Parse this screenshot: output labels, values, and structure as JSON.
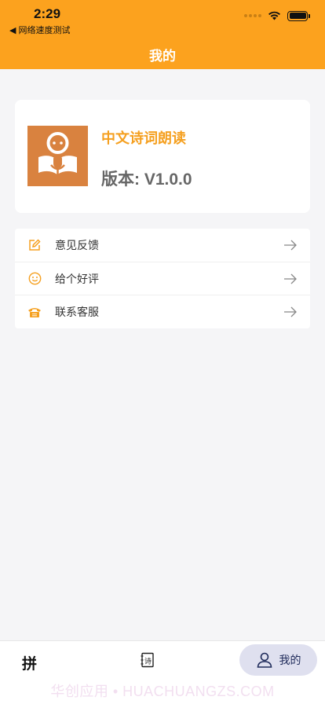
{
  "status_bar": {
    "time": "2:29",
    "back_app": "◀ 网络速度测试"
  },
  "nav": {
    "title": "我的"
  },
  "app_info": {
    "name": "中文诗词朗读",
    "version": "版本: V1.0.0",
    "logo_color": "#d9823f"
  },
  "menu": {
    "items": [
      {
        "label": "意见反馈",
        "icon": "edit-icon"
      },
      {
        "label": "给个好评",
        "icon": "smile-icon"
      },
      {
        "label": "联系客服",
        "icon": "phone-icon"
      }
    ]
  },
  "tabbar": {
    "tabs": [
      {
        "label": "拼",
        "icon": "pinyin-icon"
      },
      {
        "label": "",
        "icon": "poem-book-icon"
      },
      {
        "label": "我的",
        "icon": "user-icon",
        "active": true
      }
    ]
  },
  "watermark": "华创应用 • HUACHUANGZS.COM",
  "colors": {
    "accent": "#fca21e",
    "background": "#f5f5f7"
  }
}
